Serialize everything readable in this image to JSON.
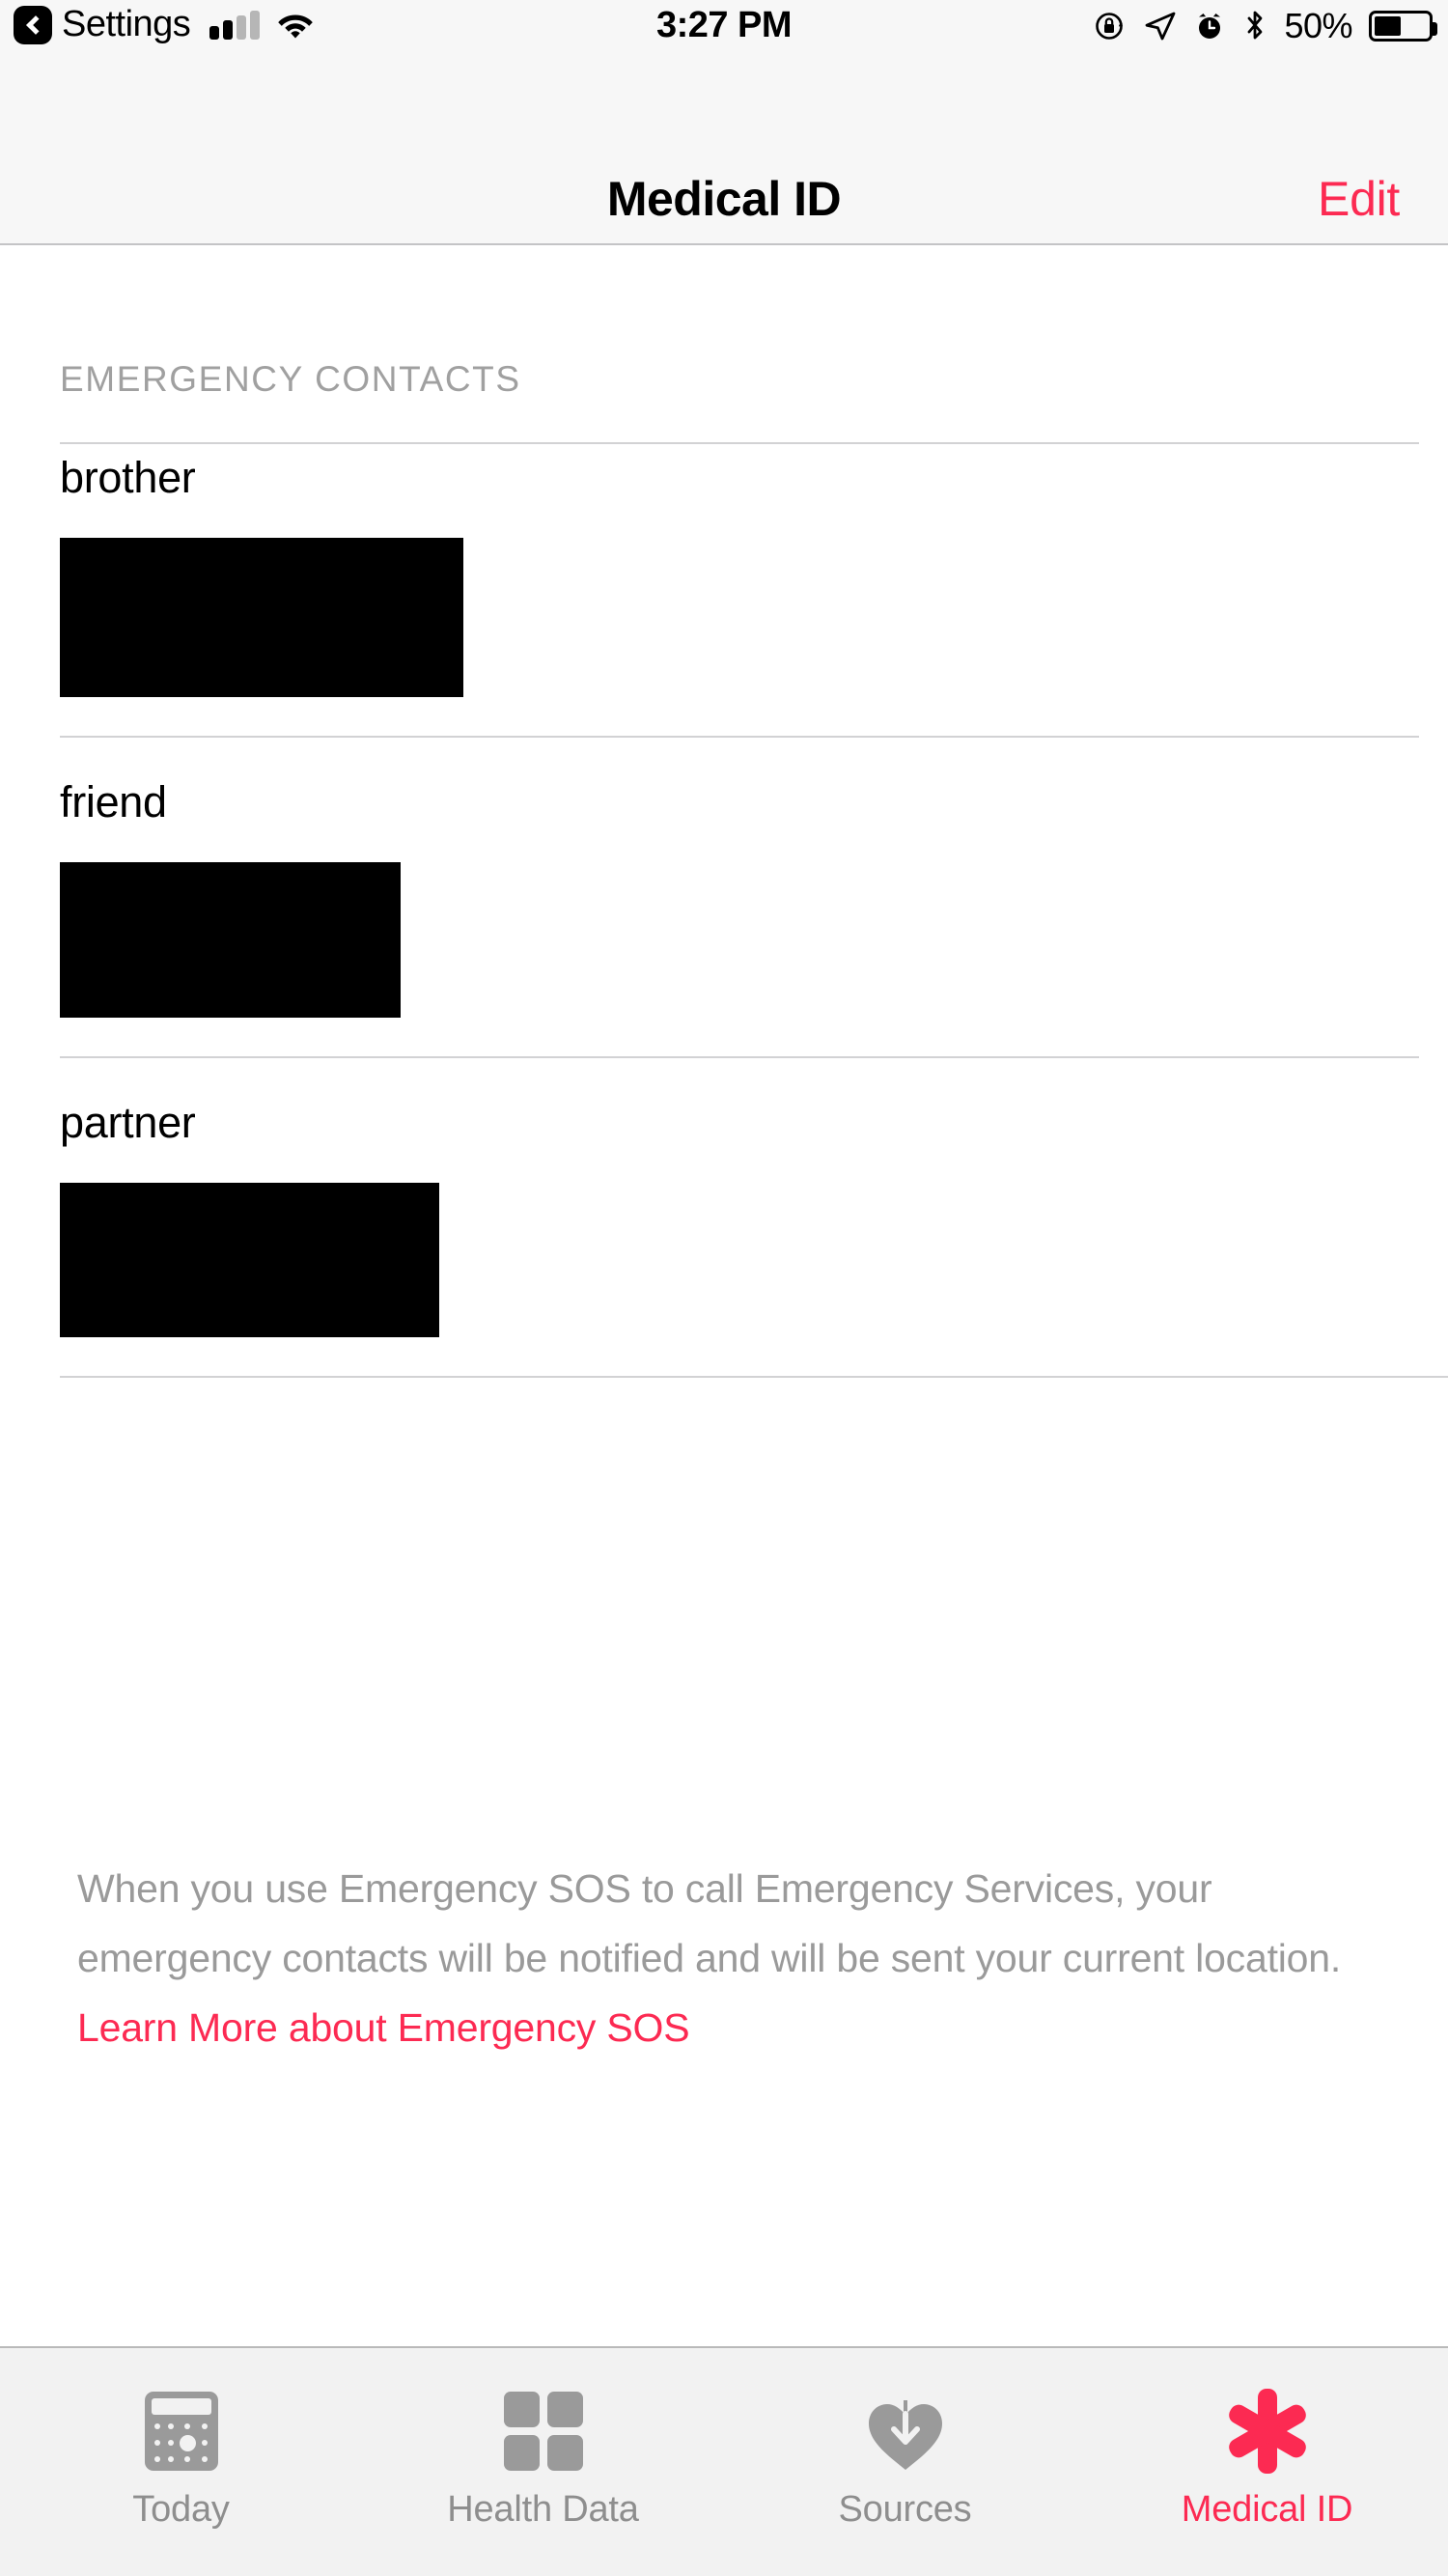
{
  "status_bar": {
    "back_icon": "chevron-left-icon",
    "back_app": "Settings",
    "signal_icon": "cellular-signal-icon",
    "signal_bars_filled": 2,
    "signal_bars_total": 4,
    "wifi_icon": "wifi-icon",
    "time": "3:27 PM",
    "right_icons": [
      "rotation-lock-icon",
      "location-arrow-icon",
      "alarm-clock-icon",
      "bluetooth-icon"
    ],
    "battery_percent": "50%",
    "battery_level": 50,
    "battery_icon": "battery-icon"
  },
  "nav_bar": {
    "title": "Medical ID",
    "edit_label": "Edit"
  },
  "main": {
    "section_header": "EMERGENCY CONTACTS",
    "contacts": [
      {
        "relationship": "brother",
        "value_redacted": true,
        "redaction_width": 418,
        "redaction_height": 165
      },
      {
        "relationship": "friend",
        "value_redacted": true,
        "redaction_width": 353,
        "redaction_height": 161
      },
      {
        "relationship": "partner",
        "value_redacted": true,
        "redaction_width": 393,
        "redaction_height": 160
      }
    ],
    "footer_note": {
      "text_before": "When you use Emergency SOS to call Emergency Services, your emergency contacts will be notified and will be sent your current location. ",
      "link_text": "Learn More about Emergency SOS"
    }
  },
  "tab_bar": {
    "tabs": [
      {
        "label": "Today",
        "icon": "calendar-today-icon",
        "active": false
      },
      {
        "label": "Health Data",
        "icon": "grid-squares-icon",
        "active": false
      },
      {
        "label": "Sources",
        "icon": "heart-download-icon",
        "active": false
      },
      {
        "label": "Medical ID",
        "icon": "medical-asterisk-icon",
        "active": true
      }
    ]
  },
  "colors": {
    "accent": "#fc2a52",
    "inactive_tab": "#8e8e8e",
    "secondary_text": "#9a9a9a",
    "bar_background": "#f7f7f7",
    "tabbar_background": "#f2f2f2",
    "separator": "#d2d2d4"
  }
}
